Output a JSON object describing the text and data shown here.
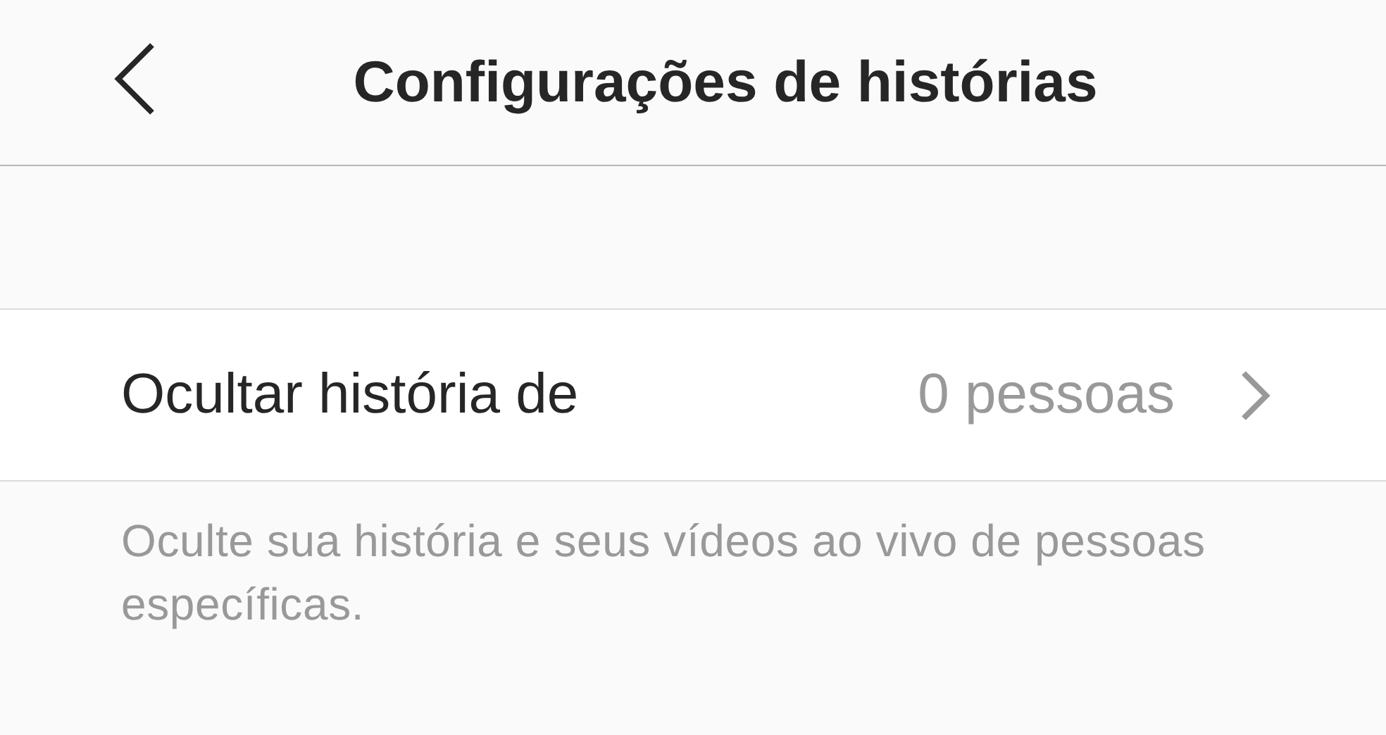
{
  "header": {
    "title": "Configurações de histórias"
  },
  "settings": [
    {
      "label": "Ocultar história de",
      "value": "0 pessoas"
    }
  ],
  "description": "Oculte sua história e seus vídeos ao vivo de pessoas específicas."
}
